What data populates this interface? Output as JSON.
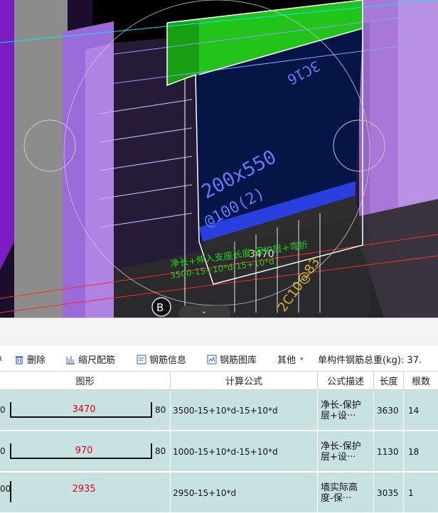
{
  "viewport": {
    "labels": {
      "dim_3470": "3470",
      "beam_size": "200x550",
      "stirrup": "@100(2)",
      "top_bars": "3C16",
      "axis_bubble": "B",
      "green_note1": "净长+伸入支座长度-保护层+弯折",
      "green_note2": "3500-15+10*d-15+10*d",
      "yellow_rebar": "2C10@83"
    },
    "collapse_tab_icon": "chevron-down-icon"
  },
  "toolbar": {
    "delete_label": "删除",
    "scale_label": "缩尺配筋",
    "rebar_info_label": "钢筋信息",
    "rebar_lib_label": "钢筋图库",
    "other_label": "其他",
    "total_weight_label": "单构件钢筋总重(kg): 37."
  },
  "table": {
    "headers": {
      "shape": "图形",
      "formula": "计算公式",
      "desc": "公式描述",
      "length": "长度",
      "count": "根数"
    },
    "rows": [
      {
        "left_leg": "0",
        "length_label": "3470",
        "right_leg": "80",
        "formula": "3500-15+10*d-15+10*d",
        "desc_line1": "净长-保护",
        "desc_line2": "层+设···",
        "length": "3630",
        "count": "14"
      },
      {
        "left_leg": "0",
        "length_label": "970",
        "right_leg": "80",
        "formula": "1000-15+10*d-15+10*d",
        "desc_line1": "净长-保护",
        "desc_line2": "层+设···",
        "length": "1130",
        "count": "18"
      },
      {
        "left_leg": "00",
        "length_label": "2935",
        "right_leg": "",
        "formula": "2950-15+10*d",
        "desc_line1": "墙实际高",
        "desc_line2": "度-保···",
        "length": "3035",
        "count": "1"
      }
    ]
  },
  "colors": {
    "row_bg": "#c8e2e2",
    "shape_length_text": "#e0001a",
    "beam_green": "#22c41a",
    "wall_purple": "#9a6ad8",
    "cad_background": "#000000"
  }
}
